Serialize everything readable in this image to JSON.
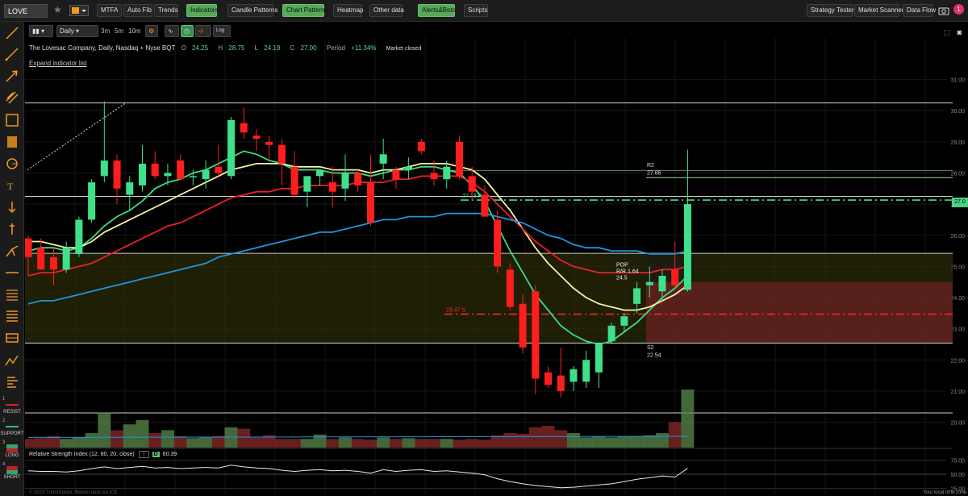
{
  "toolbar": {
    "symbol": "LOVE",
    "buttons": [
      {
        "label": "MTFA",
        "on": false
      },
      {
        "label": "Auto Fib",
        "on": false
      },
      {
        "label": "Trends",
        "on": false
      },
      {
        "label": "Indicators",
        "on": true
      },
      {
        "label": "Candle Patterns",
        "on": false
      },
      {
        "label": "Chart Patterns",
        "on": true
      },
      {
        "label": "Heatmap",
        "on": false
      },
      {
        "label": "Other data",
        "on": false
      },
      {
        "label": "Alerts&Bots",
        "on": true
      },
      {
        "label": "Scripts",
        "on": false
      },
      {
        "label": "Strategy Tester",
        "on": false
      },
      {
        "label": "Market Scanner",
        "on": false
      },
      {
        "label": "Data Flow",
        "on": false
      }
    ],
    "notification_count": "1"
  },
  "chart_controls": {
    "timeframe": "Daily",
    "intervals": [
      "3m",
      "5m",
      "10m"
    ],
    "log_label": "Log"
  },
  "legend": {
    "title": "The Lovesac Company, Daily, Nasdaq + Nyse BQT",
    "open_label": "O",
    "open": "24.25",
    "high_label": "H",
    "high": "28.75",
    "low_label": "L",
    "low": "24.19",
    "close_label": "C",
    "close": "27.00",
    "period_label": "Period",
    "period": "+11.34%",
    "status": "Market closed",
    "expand": "Expand indicator list"
  },
  "rsi_header": {
    "label": "Relative Strength Index (12, 80, 20, close)",
    "badge": "D",
    "value": "60.39"
  },
  "left_tools": {
    "labels": [
      "RESIST",
      "SUPPORT",
      "LONG",
      "SHORT"
    ],
    "numbers": [
      "1",
      "2",
      "3",
      "4"
    ]
  },
  "footer": {
    "left": "© 2023 TrendSpider. Market data via ICE",
    "right": "Your local time zone"
  },
  "colors": {
    "bull": "#3fe08a",
    "bear": "#ff1e1e",
    "ema_fast": "#3ddc84",
    "ema_mid": "#f6f0a4",
    "ema_slow": "#e8202a",
    "sma_long": "#1e95e0",
    "accent": "#56a957"
  },
  "chart_data": {
    "type": "candlestick",
    "title": "The Lovesac Company, Daily, Nasdaq + Nyse BQT",
    "ylim": [
      19.6,
      31.3
    ],
    "yticks": [
      "31.00",
      "30.00",
      "29.00",
      "28.00",
      "27.00",
      "26.00",
      "25.00",
      "24.00",
      "23.00",
      "22.00",
      "21.00",
      "20.00"
    ],
    "last_price_label": "27.0",
    "candles": [
      {
        "o": 25.9,
        "h": 26.0,
        "l": 24.7,
        "c": 25.3
      },
      {
        "o": 25.6,
        "h": 25.9,
        "l": 24.9,
        "c": 24.9
      },
      {
        "o": 25.3,
        "h": 25.6,
        "l": 24.4,
        "c": 24.9
      },
      {
        "o": 24.9,
        "h": 25.8,
        "l": 24.8,
        "c": 25.6
      },
      {
        "o": 25.4,
        "h": 26.6,
        "l": 25.3,
        "c": 26.5
      },
      {
        "o": 26.5,
        "h": 27.8,
        "l": 26.4,
        "c": 27.7
      },
      {
        "o": 27.9,
        "h": 30.3,
        "l": 27.7,
        "c": 28.4
      },
      {
        "o": 28.4,
        "h": 28.6,
        "l": 27.0,
        "c": 27.5
      },
      {
        "o": 27.3,
        "h": 27.9,
        "l": 26.8,
        "c": 27.7
      },
      {
        "o": 27.6,
        "h": 28.9,
        "l": 27.4,
        "c": 28.3
      },
      {
        "o": 28.3,
        "h": 28.7,
        "l": 27.8,
        "c": 27.9
      },
      {
        "o": 27.9,
        "h": 28.3,
        "l": 27.6,
        "c": 28.0
      },
      {
        "o": 28.4,
        "h": 28.6,
        "l": 27.8,
        "c": 27.8
      },
      {
        "o": 27.9,
        "h": 28.1,
        "l": 27.6,
        "c": 27.9
      },
      {
        "o": 27.8,
        "h": 28.4,
        "l": 27.5,
        "c": 28.1
      },
      {
        "o": 28.2,
        "h": 28.9,
        "l": 27.9,
        "c": 28.0
      },
      {
        "o": 27.9,
        "h": 29.8,
        "l": 27.8,
        "c": 29.7
      },
      {
        "o": 29.6,
        "h": 30.1,
        "l": 29.1,
        "c": 29.3
      },
      {
        "o": 29.2,
        "h": 29.4,
        "l": 28.7,
        "c": 29.1
      },
      {
        "o": 29.0,
        "h": 29.2,
        "l": 28.4,
        "c": 28.9
      },
      {
        "o": 28.9,
        "h": 29.1,
        "l": 27.6,
        "c": 28.3
      },
      {
        "o": 28.2,
        "h": 28.7,
        "l": 27.2,
        "c": 27.3
      },
      {
        "o": 27.4,
        "h": 27.6,
        "l": 26.9,
        "c": 27.9
      },
      {
        "o": 27.9,
        "h": 28.1,
        "l": 27.6,
        "c": 28.1
      },
      {
        "o": 27.7,
        "h": 28.2,
        "l": 26.9,
        "c": 27.4
      },
      {
        "o": 27.5,
        "h": 28.6,
        "l": 27.1,
        "c": 28.0
      },
      {
        "o": 28.0,
        "h": 28.1,
        "l": 27.4,
        "c": 27.6
      },
      {
        "o": 27.7,
        "h": 28.6,
        "l": 26.3,
        "c": 26.4
      },
      {
        "o": 28.3,
        "h": 29.1,
        "l": 27.8,
        "c": 28.6
      },
      {
        "o": 28.1,
        "h": 28.2,
        "l": 27.5,
        "c": 27.8
      },
      {
        "o": 28.1,
        "h": 28.5,
        "l": 27.8,
        "c": 28.2
      },
      {
        "o": 29.0,
        "h": 29.1,
        "l": 28.6,
        "c": 28.7
      },
      {
        "o": 28.0,
        "h": 28.4,
        "l": 27.6,
        "c": 27.8
      },
      {
        "o": 27.8,
        "h": 28.4,
        "l": 27.5,
        "c": 28.2
      },
      {
        "o": 29.0,
        "h": 29.2,
        "l": 27.8,
        "c": 27.9
      },
      {
        "o": 27.9,
        "h": 28.2,
        "l": 27.1,
        "c": 27.4
      },
      {
        "o": 27.3,
        "h": 27.6,
        "l": 26.6,
        "c": 26.6
      },
      {
        "o": 26.5,
        "h": 26.8,
        "l": 24.8,
        "c": 25.0
      },
      {
        "o": 24.9,
        "h": 25.1,
        "l": 23.6,
        "c": 23.7
      },
      {
        "o": 23.8,
        "h": 24.1,
        "l": 22.2,
        "c": 22.4
      },
      {
        "o": 24.2,
        "h": 24.4,
        "l": 20.9,
        "c": 21.4
      },
      {
        "o": 21.6,
        "h": 21.8,
        "l": 21.1,
        "c": 21.2
      },
      {
        "o": 21.5,
        "h": 22.4,
        "l": 20.8,
        "c": 21.0
      },
      {
        "o": 21.3,
        "h": 21.8,
        "l": 21.0,
        "c": 21.7
      },
      {
        "o": 21.3,
        "h": 22.3,
        "l": 21.1,
        "c": 22.0
      },
      {
        "o": 21.6,
        "h": 22.5,
        "l": 21.1,
        "c": 22.5
      },
      {
        "o": 22.6,
        "h": 23.2,
        "l": 22.5,
        "c": 23.1
      },
      {
        "o": 23.1,
        "h": 23.5,
        "l": 22.9,
        "c": 23.4
      },
      {
        "o": 23.8,
        "h": 24.5,
        "l": 23.5,
        "c": 24.3
      },
      {
        "o": 24.4,
        "h": 25.0,
        "l": 24.0,
        "c": 24.5
      },
      {
        "o": 24.2,
        "h": 24.9,
        "l": 23.9,
        "c": 24.7
      },
      {
        "o": 24.9,
        "h": 25.8,
        "l": 24.3,
        "c": 24.4
      },
      {
        "o": 24.25,
        "h": 28.75,
        "l": 24.19,
        "c": 27.0
      }
    ],
    "series": [
      {
        "type": "ema_fast",
        "values": [
          25.5,
          25.6,
          25.6,
          25.5,
          25.6,
          25.9,
          26.3,
          26.6,
          26.8,
          27.1,
          27.5,
          27.7,
          27.8,
          28.0,
          28.1,
          28.3,
          28.5,
          28.7,
          28.6,
          28.4,
          28.3,
          28.1,
          28.1,
          28.1,
          28.0,
          28.0,
          28.0,
          27.9,
          28.0,
          28.1,
          28.1,
          28.2,
          28.2,
          28.1,
          28.0,
          27.6,
          27.1,
          26.3,
          25.5,
          24.8,
          24.1,
          23.6,
          23.1,
          22.8,
          22.6,
          22.5,
          22.6,
          22.9,
          23.2,
          23.6,
          24.0,
          24.3,
          24.7
        ]
      },
      {
        "type": "ema_mid",
        "values": [
          25.8,
          25.8,
          25.7,
          25.6,
          25.6,
          25.8,
          26.1,
          26.3,
          26.5,
          26.7,
          26.9,
          27.1,
          27.3,
          27.5,
          27.7,
          27.9,
          28.1,
          28.2,
          28.3,
          28.3,
          28.3,
          28.2,
          28.2,
          28.2,
          28.1,
          28.1,
          28.1,
          28.0,
          28.1,
          28.1,
          28.2,
          28.3,
          28.3,
          28.3,
          28.2,
          28.1,
          27.8,
          27.3,
          26.8,
          26.2,
          25.6,
          25.1,
          24.7,
          24.3,
          24.0,
          23.8,
          23.7,
          23.6,
          23.6,
          23.7,
          23.9,
          24.1,
          24.4
        ]
      },
      {
        "type": "ema_slow",
        "values": [
          24.7,
          24.8,
          24.8,
          24.9,
          25.0,
          25.1,
          25.3,
          25.5,
          25.7,
          25.9,
          26.1,
          26.3,
          26.4,
          26.6,
          26.8,
          27.0,
          27.2,
          27.3,
          27.4,
          27.4,
          27.5,
          27.5,
          27.6,
          27.6,
          27.6,
          27.6,
          27.7,
          27.7,
          27.7,
          27.8,
          27.8,
          27.9,
          27.9,
          27.9,
          27.9,
          27.7,
          27.4,
          27.0,
          26.6,
          26.2,
          25.8,
          25.5,
          25.2,
          25.0,
          24.9,
          24.8,
          24.8,
          24.8,
          24.8,
          24.8,
          24.9,
          24.9,
          25.0
        ]
      },
      {
        "type": "sma_long",
        "values": [
          23.8,
          23.9,
          23.9,
          24.0,
          24.1,
          24.2,
          24.3,
          24.4,
          24.5,
          24.6,
          24.7,
          24.8,
          24.9,
          25.0,
          25.1,
          25.3,
          25.4,
          25.5,
          25.6,
          25.7,
          25.8,
          25.9,
          26.0,
          26.1,
          26.1,
          26.2,
          26.3,
          26.4,
          26.5,
          26.5,
          26.6,
          26.6,
          26.6,
          26.7,
          26.7,
          26.7,
          26.7,
          26.6,
          26.5,
          26.4,
          26.2,
          26.0,
          25.9,
          25.7,
          25.6,
          25.6,
          25.5,
          25.5,
          25.5,
          25.4,
          25.4,
          25.4,
          25.5
        ]
      }
    ],
    "volume": [
      0.12,
      0.13,
      0.16,
      0.12,
      0.14,
      0.2,
      0.48,
      0.24,
      0.32,
      0.38,
      0.2,
      0.24,
      0.16,
      0.13,
      0.14,
      0.16,
      0.28,
      0.26,
      0.14,
      0.17,
      0.12,
      0.12,
      0.12,
      0.18,
      0.12,
      0.14,
      0.12,
      0.11,
      0.14,
      0.12,
      0.13,
      0.12,
      0.12,
      0.12,
      0.11,
      0.12,
      0.11,
      0.17,
      0.2,
      0.19,
      0.28,
      0.3,
      0.24,
      0.2,
      0.14,
      0.15,
      0.14,
      0.15,
      0.16,
      0.17,
      0.2,
      0.35,
      0.8
    ],
    "rsi": {
      "ylim": [
        20,
        80
      ],
      "values": [
        56,
        55,
        55,
        54,
        56,
        60,
        63,
        60,
        62,
        64,
        61,
        62,
        60,
        61,
        62,
        61,
        66,
        63,
        61,
        60,
        57,
        55,
        57,
        58,
        56,
        57,
        55,
        52,
        58,
        55,
        57,
        58,
        55,
        56,
        54,
        52,
        49,
        42,
        37,
        33,
        30,
        28,
        26,
        27,
        29,
        31,
        33,
        37,
        41,
        44,
        47,
        45,
        60.39
      ],
      "levels": [
        "75.00",
        "50.00",
        "25.00"
      ]
    },
    "levels": [
      {
        "price": 30.25,
        "color": "#cfcfcf",
        "style": "solid"
      },
      {
        "price": 28.08,
        "color": "#5d8e5d",
        "style": "solid"
      },
      {
        "price": 27.85,
        "color": "#9fd39f",
        "style": "solid"
      },
      {
        "price": 27.25,
        "color": "#cfcfcf",
        "style": "solid"
      },
      {
        "price": 27.13,
        "color": "#3fe08a",
        "style": "dashdot",
        "label": "27.13 R"
      },
      {
        "price": 25.42,
        "color": "#cfcfcf",
        "style": "solid"
      },
      {
        "price": 23.47,
        "color": "#ff2828",
        "style": "dashdot",
        "label": "23.47 S"
      },
      {
        "price": 22.54,
        "color": "#cfcfcf",
        "style": "solid"
      },
      {
        "price": 20.3,
        "color": "#cfcfcf",
        "style": "solid"
      }
    ],
    "pivots": [
      {
        "name": "R2",
        "value": "27.86"
      },
      {
        "name": "S2",
        "value": "22.54"
      }
    ],
    "trade_box": {
      "text": [
        "POP",
        "R/R 1.64",
        "24.5"
      ]
    }
  }
}
